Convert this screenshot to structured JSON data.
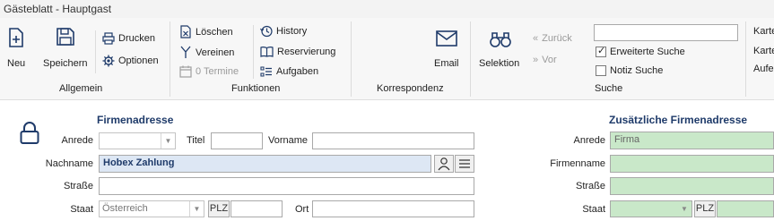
{
  "window": {
    "title": "Gästeblatt - Hauptgast"
  },
  "ribbon": {
    "allgemein": {
      "label": "Allgemein",
      "neu": "Neu",
      "speichern": "Speichern",
      "drucken": "Drucken",
      "optionen": "Optionen"
    },
    "funktionen": {
      "label": "Funktionen",
      "loeschen": "Löschen",
      "vereinen": "Vereinen",
      "termine": "0 Termine",
      "history": "History",
      "reservierung": "Reservierung",
      "aufgaben": "Aufgaben"
    },
    "korrespondenz": {
      "label": "Korrespondenz",
      "email": "Email"
    },
    "suche": {
      "label": "Suche",
      "selektion": "Selektion",
      "zurueck": "Zurück",
      "vor": "Vor",
      "search_value": "",
      "erweiterte": "Erweiterte Suche",
      "erweiterte_checked": true,
      "notiz": "Notiz Suche",
      "notiz_checked": false
    },
    "overflow": {
      "item1": "Karte",
      "item2": "Karte",
      "item3": "Aufe"
    }
  },
  "firmenadresse": {
    "title": "Firmenadresse",
    "anrede_label": "Anrede",
    "anrede_value": "",
    "titel_label": "Titel",
    "titel_value": "",
    "vorname_label": "Vorname",
    "vorname_value": "",
    "nachname_label": "Nachname",
    "nachname_value": "Hobex Zahlung",
    "strasse_label": "Straße",
    "strasse_value": "",
    "staat_label": "Staat",
    "staat_value": "Österreich",
    "plz_label": "PLZ",
    "plz_value": "",
    "ort_label": "Ort",
    "ort_value": ""
  },
  "zusaetzlich": {
    "title": "Zusätzliche Firmenadresse",
    "anrede_label": "Anrede",
    "anrede_value": "Firma",
    "firmenname_label": "Firmenname",
    "firmenname_value": "",
    "strasse_label": "Straße",
    "strasse_value": "",
    "staat_label": "Staat",
    "staat_value": "",
    "plz_label": "PLZ"
  }
}
